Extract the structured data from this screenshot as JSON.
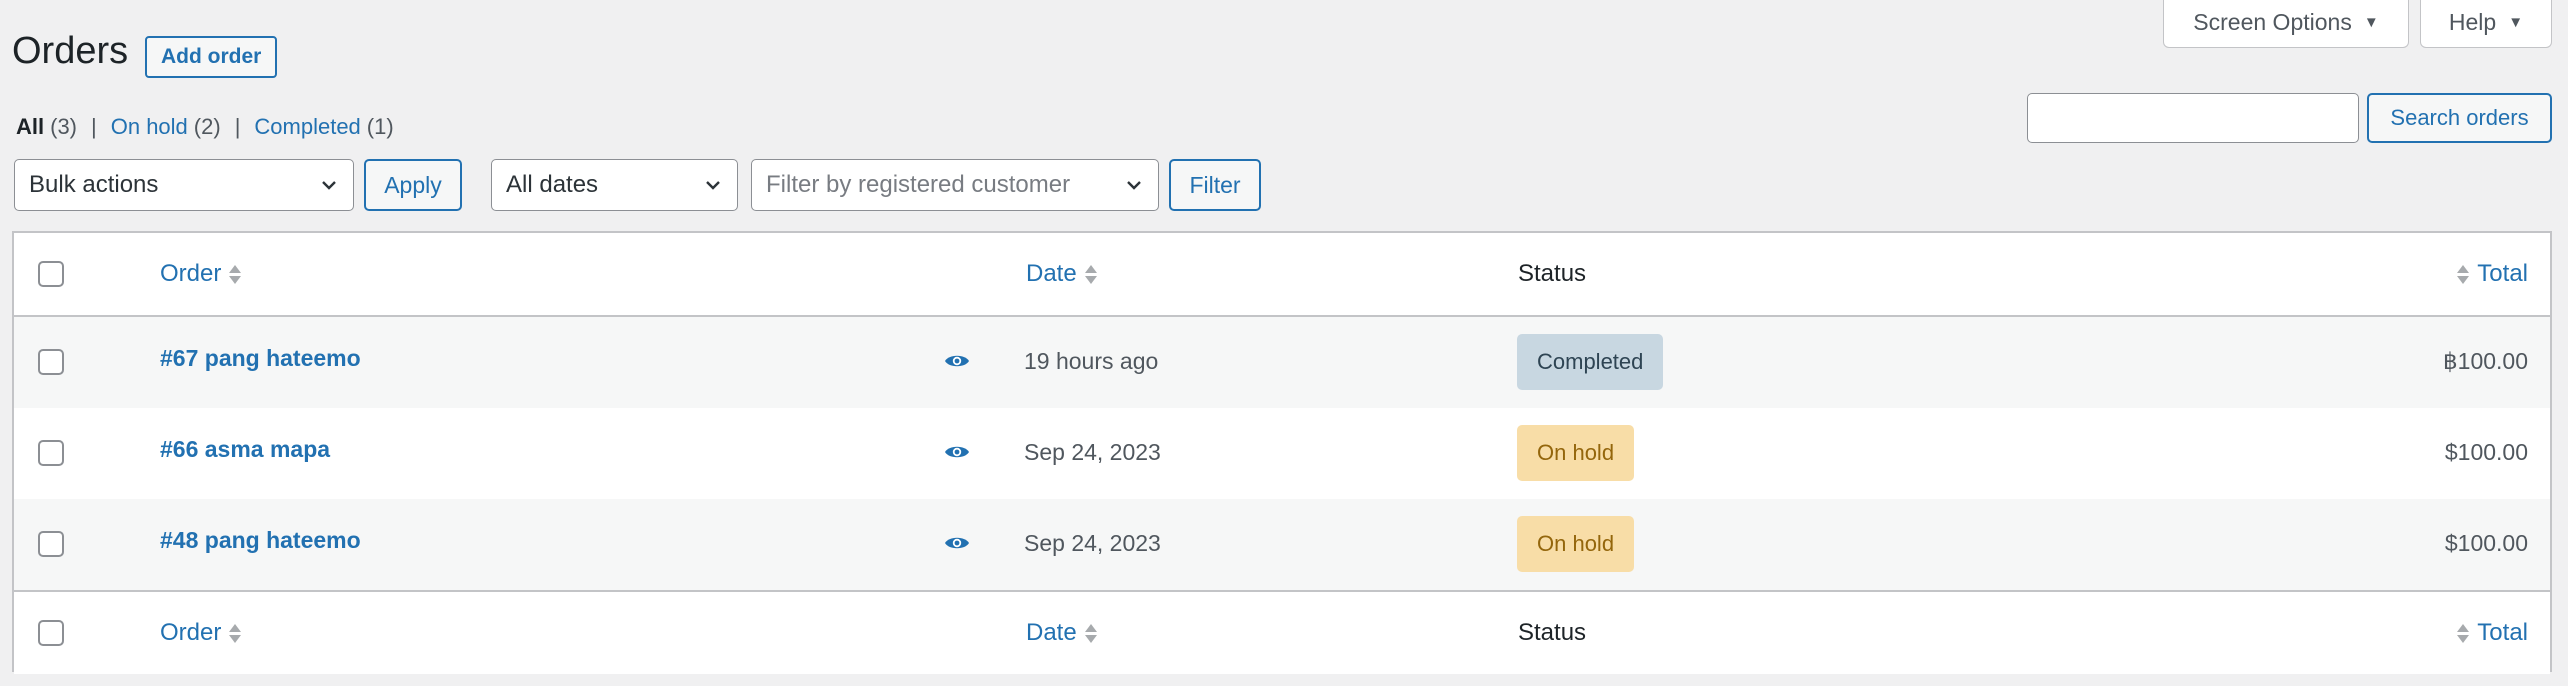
{
  "top_tabs": {
    "screen_options": "Screen Options",
    "help": "Help"
  },
  "header": {
    "title": "Orders",
    "add_button": "Add order"
  },
  "filters_links": [
    {
      "label": "All",
      "count": "(3)",
      "current": true
    },
    {
      "label": "On hold",
      "count": "(2)",
      "current": false
    },
    {
      "label": "Completed",
      "count": "(1)",
      "current": false
    }
  ],
  "filters_separator": "|",
  "search": {
    "value": "",
    "button": "Search orders"
  },
  "toolbar": {
    "bulk_actions": "Bulk actions",
    "apply": "Apply",
    "dates": "All dates",
    "customer_placeholder": "Filter by registered customer",
    "filter": "Filter"
  },
  "columns": {
    "order": "Order",
    "date": "Date",
    "status": "Status",
    "total": "Total"
  },
  "rows": [
    {
      "order": "#67 pang hateemo",
      "date": "19 hours ago",
      "status": "Completed",
      "total": "฿100.00"
    },
    {
      "order": "#66 asma mapa",
      "date": "Sep 24, 2023",
      "status": "On hold",
      "total": "$100.00"
    },
    {
      "order": "#48 pang hateemo",
      "date": "Sep 24, 2023",
      "status": "On hold",
      "total": "$100.00"
    }
  ],
  "status_colors": {
    "Completed": {
      "bg": "#c8d7e1",
      "fg": "#2e4453"
    },
    "On hold": {
      "bg": "#f8dda7",
      "fg": "#94660c"
    }
  },
  "accent_color": "#2271b1",
  "icons": {
    "preview": "eye-icon",
    "sort": "sort-arrows-icon",
    "dropdown": "chevron-down-icon",
    "tab_toggle": "triangle-down-icon"
  }
}
